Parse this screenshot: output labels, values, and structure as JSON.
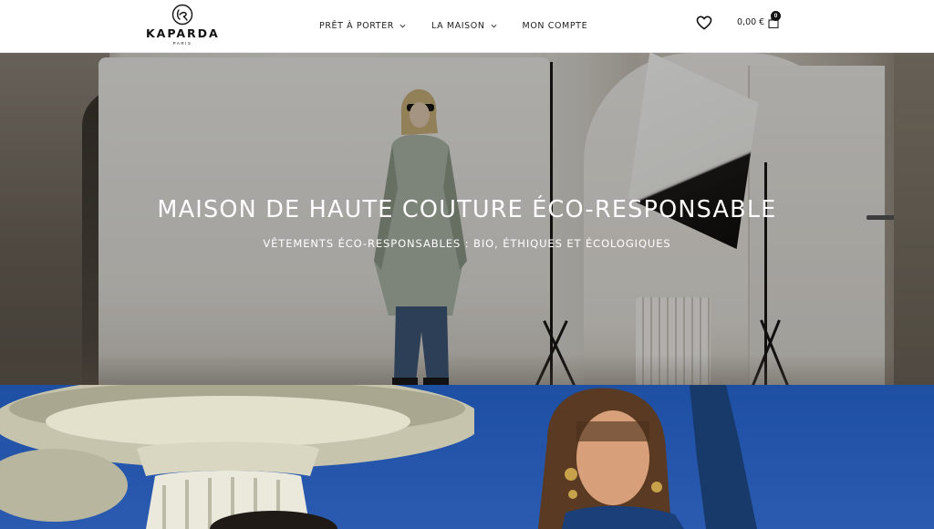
{
  "header": {
    "logo": {
      "monogram": "KP",
      "name": "KAPARDA",
      "subtitle": "PARIS"
    },
    "nav": [
      {
        "label": "PRÊT À PORTER",
        "has_dropdown": true
      },
      {
        "label": "LA MAISON",
        "has_dropdown": true
      },
      {
        "label": "MON COMPTE",
        "has_dropdown": false
      }
    ],
    "wishlist_icon": "heart-icon",
    "cart": {
      "price": "0,00 €",
      "count": "0",
      "icon": "shopping-bag-icon"
    }
  },
  "hero": {
    "title": "MAISON DE HAUTE COUTURE ÉCO-RESPONSABLE",
    "subtitle": "VÊTEMENTS ÉCO-RESPONSABLES : BIO, ÉTHIQUES ET ÉCOLOGIQUES"
  },
  "colors": {
    "header_bg": "#ffffff",
    "text_dark": "#222222",
    "hero_text": "#ffffff",
    "sky_blue": "#2455ab",
    "badge_bg": "#111111"
  }
}
